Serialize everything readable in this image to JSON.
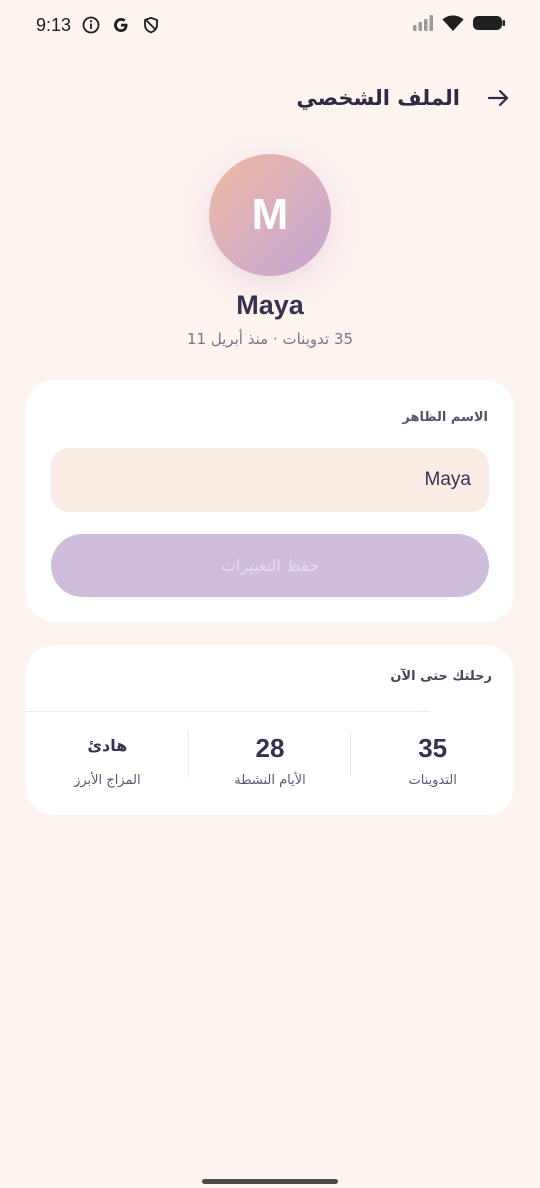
{
  "status_bar": {
    "time": "9:13",
    "icons": [
      "info-icon",
      "google-icon",
      "shield-icon",
      "signal-icon",
      "wifi-icon",
      "battery-icon"
    ]
  },
  "header": {
    "title": "الملف الشخصي",
    "back_icon": "arrow-back-icon"
  },
  "profile": {
    "avatar_letter": "M",
    "name": "Maya",
    "subtitle": "35 تدوينات · منذ أبريل 11"
  },
  "edit_card": {
    "field_label": "الاسم الظاهر",
    "name_value": "Maya",
    "save_label": "حفظ التغييرات"
  },
  "stats_card": {
    "title": "رحلتك حتى الآن",
    "stats": [
      {
        "value": "35",
        "label": "التدوينات"
      },
      {
        "value": "28",
        "label": "الأيام النشطة"
      },
      {
        "value": "هادئ",
        "label": "المزاج الأبرز"
      }
    ]
  },
  "colors": {
    "background": "#fdf4f0",
    "accent_disabled": "#cfbedb",
    "avatar_gradient_start": "#f0b8a0",
    "avatar_gradient_end": "#c4a5d2",
    "text_primary": "#3a3150"
  }
}
